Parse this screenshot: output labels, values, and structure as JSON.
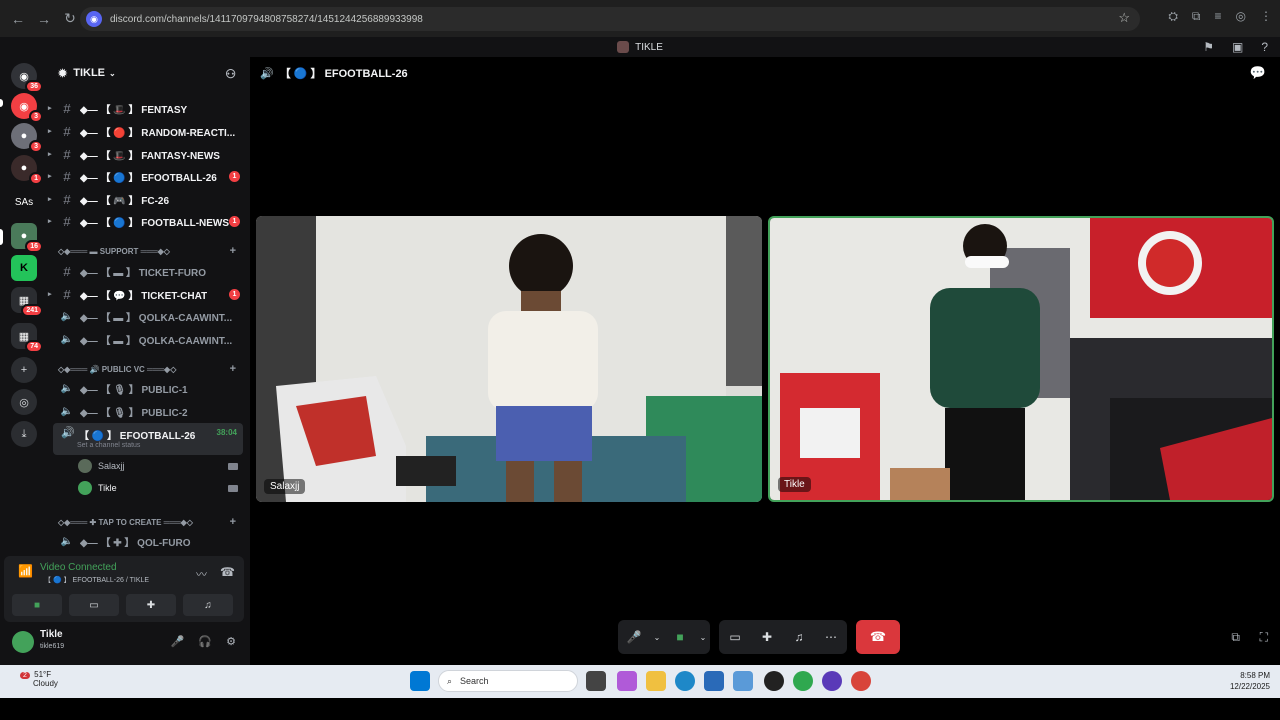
{
  "browser": {
    "url": "discord.com/channels/1411709794808758274/1451244256889933998",
    "back_icon": "arrow-left",
    "forward_icon": "arrow-right",
    "reload_icon": "reload"
  },
  "window": {
    "title": "TIKLE"
  },
  "server_rail": {
    "badges": [
      "36",
      "3",
      "3",
      "1",
      "SAs",
      "16",
      "241",
      "74"
    ]
  },
  "sidebar": {
    "server_name": "TIKLE",
    "channels": [
      {
        "label": "◆— 【 🎩 】 FENTASY",
        "unread": true,
        "badge": ""
      },
      {
        "label": "◆— 【 🔴 】 RANDOM-REACTI...",
        "unread": true,
        "badge": ""
      },
      {
        "label": "◆— 【 🎩 】 FANTASY-NEWS",
        "unread": true,
        "badge": ""
      },
      {
        "label": "◆— 【 🔵 】 EFOOTBALL-26",
        "unread": true,
        "badge": "1"
      },
      {
        "label": "◆— 【 🎮 】 FC-26",
        "unread": true,
        "badge": ""
      },
      {
        "label": "◆— 【 🔵 】 FOOTBALL-NEWS",
        "unread": true,
        "badge": "1"
      }
    ],
    "category_support": "◇◆═══ ▬ SUPPORT ═══◆◇",
    "support_channels": [
      {
        "label": "◆— 【 ▬ 】 TICKET-FURO",
        "unread": false,
        "badge": ""
      },
      {
        "label": "◆— 【 💬 】 TICKET-CHAT",
        "unread": true,
        "badge": "1"
      },
      {
        "label": "◆— 【 ▬ 】 QOLKA-CAAWINT...",
        "unread": false,
        "badge": ""
      },
      {
        "label": "◆— 【 ▬ 】 QOLKA-CAAWINT...",
        "unread": false,
        "badge": ""
      }
    ],
    "category_public": "◇◆═══ 🔊 PUBLIC VC ═══◆◇",
    "public_channels": [
      {
        "label": "◆— 【 🎙 】 PUBLIC-1"
      },
      {
        "label": "◆— 【 🎙 】 PUBLIC-2"
      }
    ],
    "active_channel": {
      "label": "【 🔵 】 EFOOTBALL-26",
      "timer": "38:04",
      "status": "Set a channel status"
    },
    "voice_users": [
      "Salaxjj",
      "Tikle"
    ],
    "category_tap": "◇◆═══ ✚ TAP TO CREATE ═══◆◇",
    "tap_channel": "◆— 【 ✚ 】 QOL-FURO"
  },
  "voice_panel": {
    "status": "Video Connected",
    "sub": "【 🔵 】 EFOOTBALL-26 / TIKLE"
  },
  "user_panel": {
    "name": "Tikle",
    "tag": "tikle619"
  },
  "stage": {
    "channel_title": "【 🔵 】 EFOOTBALL-26",
    "tiles": [
      {
        "name": "Salaxjj"
      },
      {
        "name": "Tikle"
      }
    ]
  },
  "taskbar": {
    "weather_temp": "51°F",
    "weather_desc": "Cloudy",
    "weather_badge": "2",
    "search_placeholder": "Search",
    "time": "8:58 PM",
    "date": "12/22/2025"
  },
  "colors": {
    "discord_bg": "#121214",
    "accent_green": "#43a25a",
    "danger_red": "#da373c",
    "blurple": "#5865f2"
  }
}
